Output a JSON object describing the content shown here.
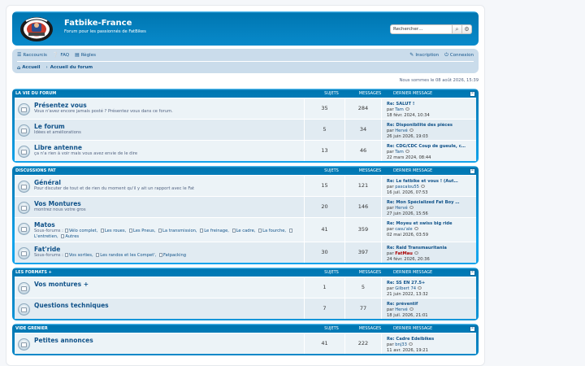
{
  "header": {
    "site_title": "Fatbike-France",
    "site_desc": "Forum pour les passionnés de FatBikes",
    "search_placeholder": "Rechercher…"
  },
  "nav": {
    "shortcuts": "Raccourcis",
    "faq": "FAQ",
    "rules": "Règles",
    "register": "Inscription",
    "login": "Connexion",
    "home": "Accueil",
    "forum_index": "Accueil du forum"
  },
  "current_date": "Nous sommes le 08 août 2026, 15:39",
  "columns": {
    "topics": "SUJETS",
    "posts": "MESSAGES",
    "last": "DERNIER MESSAGE"
  },
  "categories": [
    {
      "name": "LA VIE DU FORUM",
      "forums": [
        {
          "title": "Présentez vous",
          "desc": "Vous n'avez encore jamais posté ? Présentez vous dans ce forum.",
          "topics": "35",
          "posts": "284",
          "last_title": "Re: SALUT !",
          "by": "par",
          "last_user": "Tam",
          "last_date": "18 févr. 2024, 10:34"
        },
        {
          "title": "Le forum",
          "desc": "Idées et améliorations",
          "topics": "5",
          "posts": "34",
          "last_title": "Re: Disponibilité des pièces",
          "by": "par",
          "last_user": "Hervé",
          "last_date": "26 juin 2026, 19:03"
        },
        {
          "title": "Libre antenne",
          "desc": "ça n'a rien à voir mais vous avez envie de le dire",
          "topics": "13",
          "posts": "46",
          "last_title": "Re: CDG/CDC Coup de gueule, c…",
          "by": "par",
          "last_user": "Tam",
          "last_date": "22 mars 2024, 08:44"
        }
      ]
    },
    {
      "name": "DISCUSSIONS FAT",
      "forums": [
        {
          "title": "Général",
          "desc": "Pour discuter de tout et de rien du moment qu'il y ait un rapport avec le Fat",
          "topics": "15",
          "posts": "121",
          "last_title": "Re: Le fatbike et vous ! (Aut…",
          "by": "par",
          "last_user": "pascalou55",
          "last_date": "16 juil. 2026, 07:53"
        },
        {
          "title": "Vos Montures",
          "desc": "montrez nous votre gros",
          "topics": "20",
          "posts": "146",
          "last_title": "Re: Mon Spécialized Fat Boy …",
          "by": "par",
          "last_user": "Hervé",
          "last_date": "27 juin 2026, 15:56"
        },
        {
          "title": "Matos",
          "sub_label": "Sous-forums :",
          "subforums": [
            "Vélo complet,",
            "Les roues,",
            "Les Pneus,",
            "La transmission,",
            "Le freinage,",
            "Le cadre,",
            "La fourche,",
            "L'entretien,",
            "Autres"
          ],
          "topics": "41",
          "posts": "359",
          "last_title": "Re: Moyeu et swiss big ride",
          "by": "par",
          "last_user": "casu'ale",
          "last_date": "02 mai 2026, 03:59"
        },
        {
          "title": "Fat'ride",
          "sub_label": "Sous-forums :",
          "subforums": [
            "Vos sorties,",
            "Les randos et les Compet',",
            "Fatpacking"
          ],
          "topics": "30",
          "posts": "397",
          "last_title": "Re: Raid Transmauritania",
          "by": "par",
          "last_user": "FatMau",
          "last_user_red": true,
          "last_date": "24 févr. 2026, 20:36"
        }
      ]
    },
    {
      "name": "LES FORMATS +",
      "forums": [
        {
          "title": "Vos montures +",
          "desc": "",
          "topics": "1",
          "posts": "5",
          "last_title": "Re: SS EN 27.5+",
          "by": "par",
          "last_user": "Gilbert 74",
          "last_date": "21 juin 2022, 13:32"
        },
        {
          "title": "Questions techniques",
          "desc": "",
          "topics": "7",
          "posts": "77",
          "last_title": "Re: préventif",
          "by": "par",
          "last_user": "Hervé",
          "last_date": "18 juil. 2026, 21:01"
        }
      ]
    },
    {
      "name": "VIDE GRENIER",
      "forums": [
        {
          "title": "Petites annonces",
          "desc": "",
          "topics": "41",
          "posts": "222",
          "last_title": "Re: Cadre Edelbikes",
          "by": "par",
          "last_user": "bnj33",
          "last_date": "11 avr. 2026, 19:21"
        }
      ]
    }
  ],
  "colors": {
    "header_blue": "#12a3eb",
    "link": "#105289",
    "row_bg": "#ecf3f7",
    "row_alt": "#e1ebf2"
  }
}
